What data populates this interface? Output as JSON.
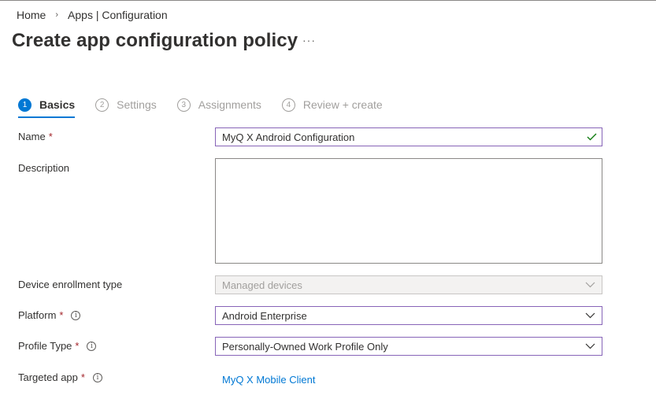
{
  "breadcrumb": {
    "home": "Home",
    "separator": "›",
    "current": "Apps | Configuration"
  },
  "page": {
    "title": "Create app configuration policy",
    "more": "···"
  },
  "steps": [
    {
      "num": "1",
      "label": "Basics"
    },
    {
      "num": "2",
      "label": "Settings"
    },
    {
      "num": "3",
      "label": "Assignments"
    },
    {
      "num": "4",
      "label": "Review + create"
    }
  ],
  "form": {
    "required_mark": "*",
    "info_glyph": "i",
    "name": {
      "label": "Name",
      "value": "MyQ X Android Configuration"
    },
    "description": {
      "label": "Description",
      "value": ""
    },
    "enrollment": {
      "label": "Device enrollment type",
      "value": "Managed devices"
    },
    "platform": {
      "label": "Platform",
      "value": "Android Enterprise"
    },
    "profile_type": {
      "label": "Profile Type",
      "value": "Personally-Owned Work Profile Only"
    },
    "targeted_app": {
      "label": "Targeted app",
      "value": "MyQ X Mobile Client"
    }
  },
  "colors": {
    "accent": "#0078d4",
    "focus_border": "#8764b8",
    "required": "#a4262c",
    "valid": "#107c10"
  },
  "icons": {
    "chevron": "chevron-down-icon",
    "check": "checkmark-icon",
    "info": "info-icon"
  }
}
